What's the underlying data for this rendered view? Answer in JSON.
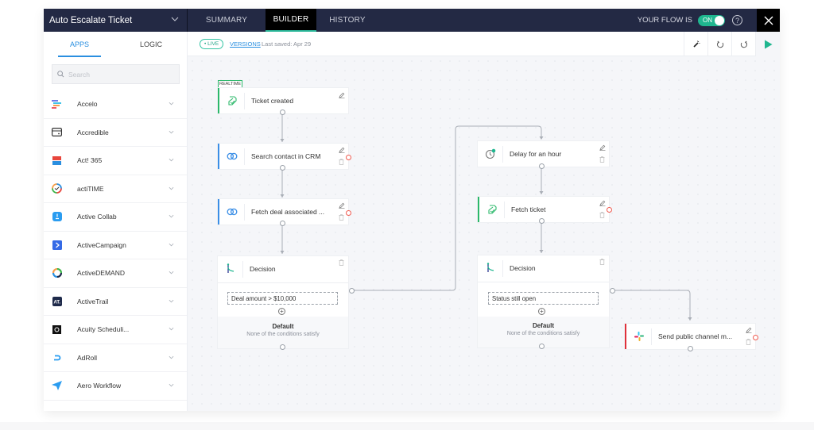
{
  "header": {
    "flow_name": "Auto Escalate Ticket",
    "tabs": [
      {
        "label": "SUMMARY",
        "active": false
      },
      {
        "label": "BUILDER",
        "active": true
      },
      {
        "label": "HISTORY",
        "active": false
      }
    ],
    "flow_status_label": "YOUR FLOW IS",
    "toggle_label": "ON",
    "toggle_on": true,
    "help_glyph": "?",
    "accent": "#1fb68f"
  },
  "sidebar": {
    "tabs": [
      {
        "label": "APPS",
        "active": true
      },
      {
        "label": "LOGIC",
        "active": false
      }
    ],
    "search_placeholder": "Search",
    "apps": [
      {
        "name": "Accelo",
        "icon": "accelo-icon"
      },
      {
        "name": "Accredible",
        "icon": "accredible-icon"
      },
      {
        "name": "Act! 365",
        "icon": "act365-icon"
      },
      {
        "name": "actiTIME",
        "icon": "actitime-icon"
      },
      {
        "name": "Active Collab",
        "icon": "activecollab-icon"
      },
      {
        "name": "ActiveCampaign",
        "icon": "activecampaign-icon"
      },
      {
        "name": "ActiveDEMAND",
        "icon": "activedemand-icon"
      },
      {
        "name": "ActiveTrail",
        "icon": "activetrail-icon"
      },
      {
        "name": "Acuity Scheduli...",
        "icon": "acuity-icon"
      },
      {
        "name": "AdRoll",
        "icon": "adroll-icon"
      },
      {
        "name": "Aero Workflow",
        "icon": "aeroworkflow-icon"
      }
    ]
  },
  "subbar": {
    "live_label": "• LIVE",
    "versions_label": "VERSIONS",
    "last_saved": "Last saved: Apr 29"
  },
  "canvas": {
    "trigger_badge": "REALTIME",
    "nodes": [
      {
        "id": "ticket-created",
        "title": "Ticket created",
        "icon": "ticket-icon"
      },
      {
        "id": "search-contact",
        "title": "Search contact in CRM",
        "icon": "crm-link-icon"
      },
      {
        "id": "fetch-deal",
        "title": "Fetch deal associated ...",
        "icon": "crm-link-icon"
      },
      {
        "id": "decision-1",
        "title": "Decision",
        "icon": "decision-icon"
      },
      {
        "id": "delay",
        "title": "Delay for an hour",
        "icon": "clock-icon"
      },
      {
        "id": "fetch-ticket",
        "title": "Fetch ticket",
        "icon": "ticket-icon"
      },
      {
        "id": "decision-2",
        "title": "Decision",
        "icon": "decision-icon"
      },
      {
        "id": "slack-send",
        "title": "Send public channel m...",
        "icon": "slack-icon"
      }
    ],
    "decision_1": {
      "condition": "Deal amount > $10,000",
      "default_title": "Default",
      "default_subtitle": "None of the conditions satisfy"
    },
    "decision_2": {
      "condition": "Status still open",
      "default_title": "Default",
      "default_subtitle": "None of the conditions satisfy"
    }
  }
}
